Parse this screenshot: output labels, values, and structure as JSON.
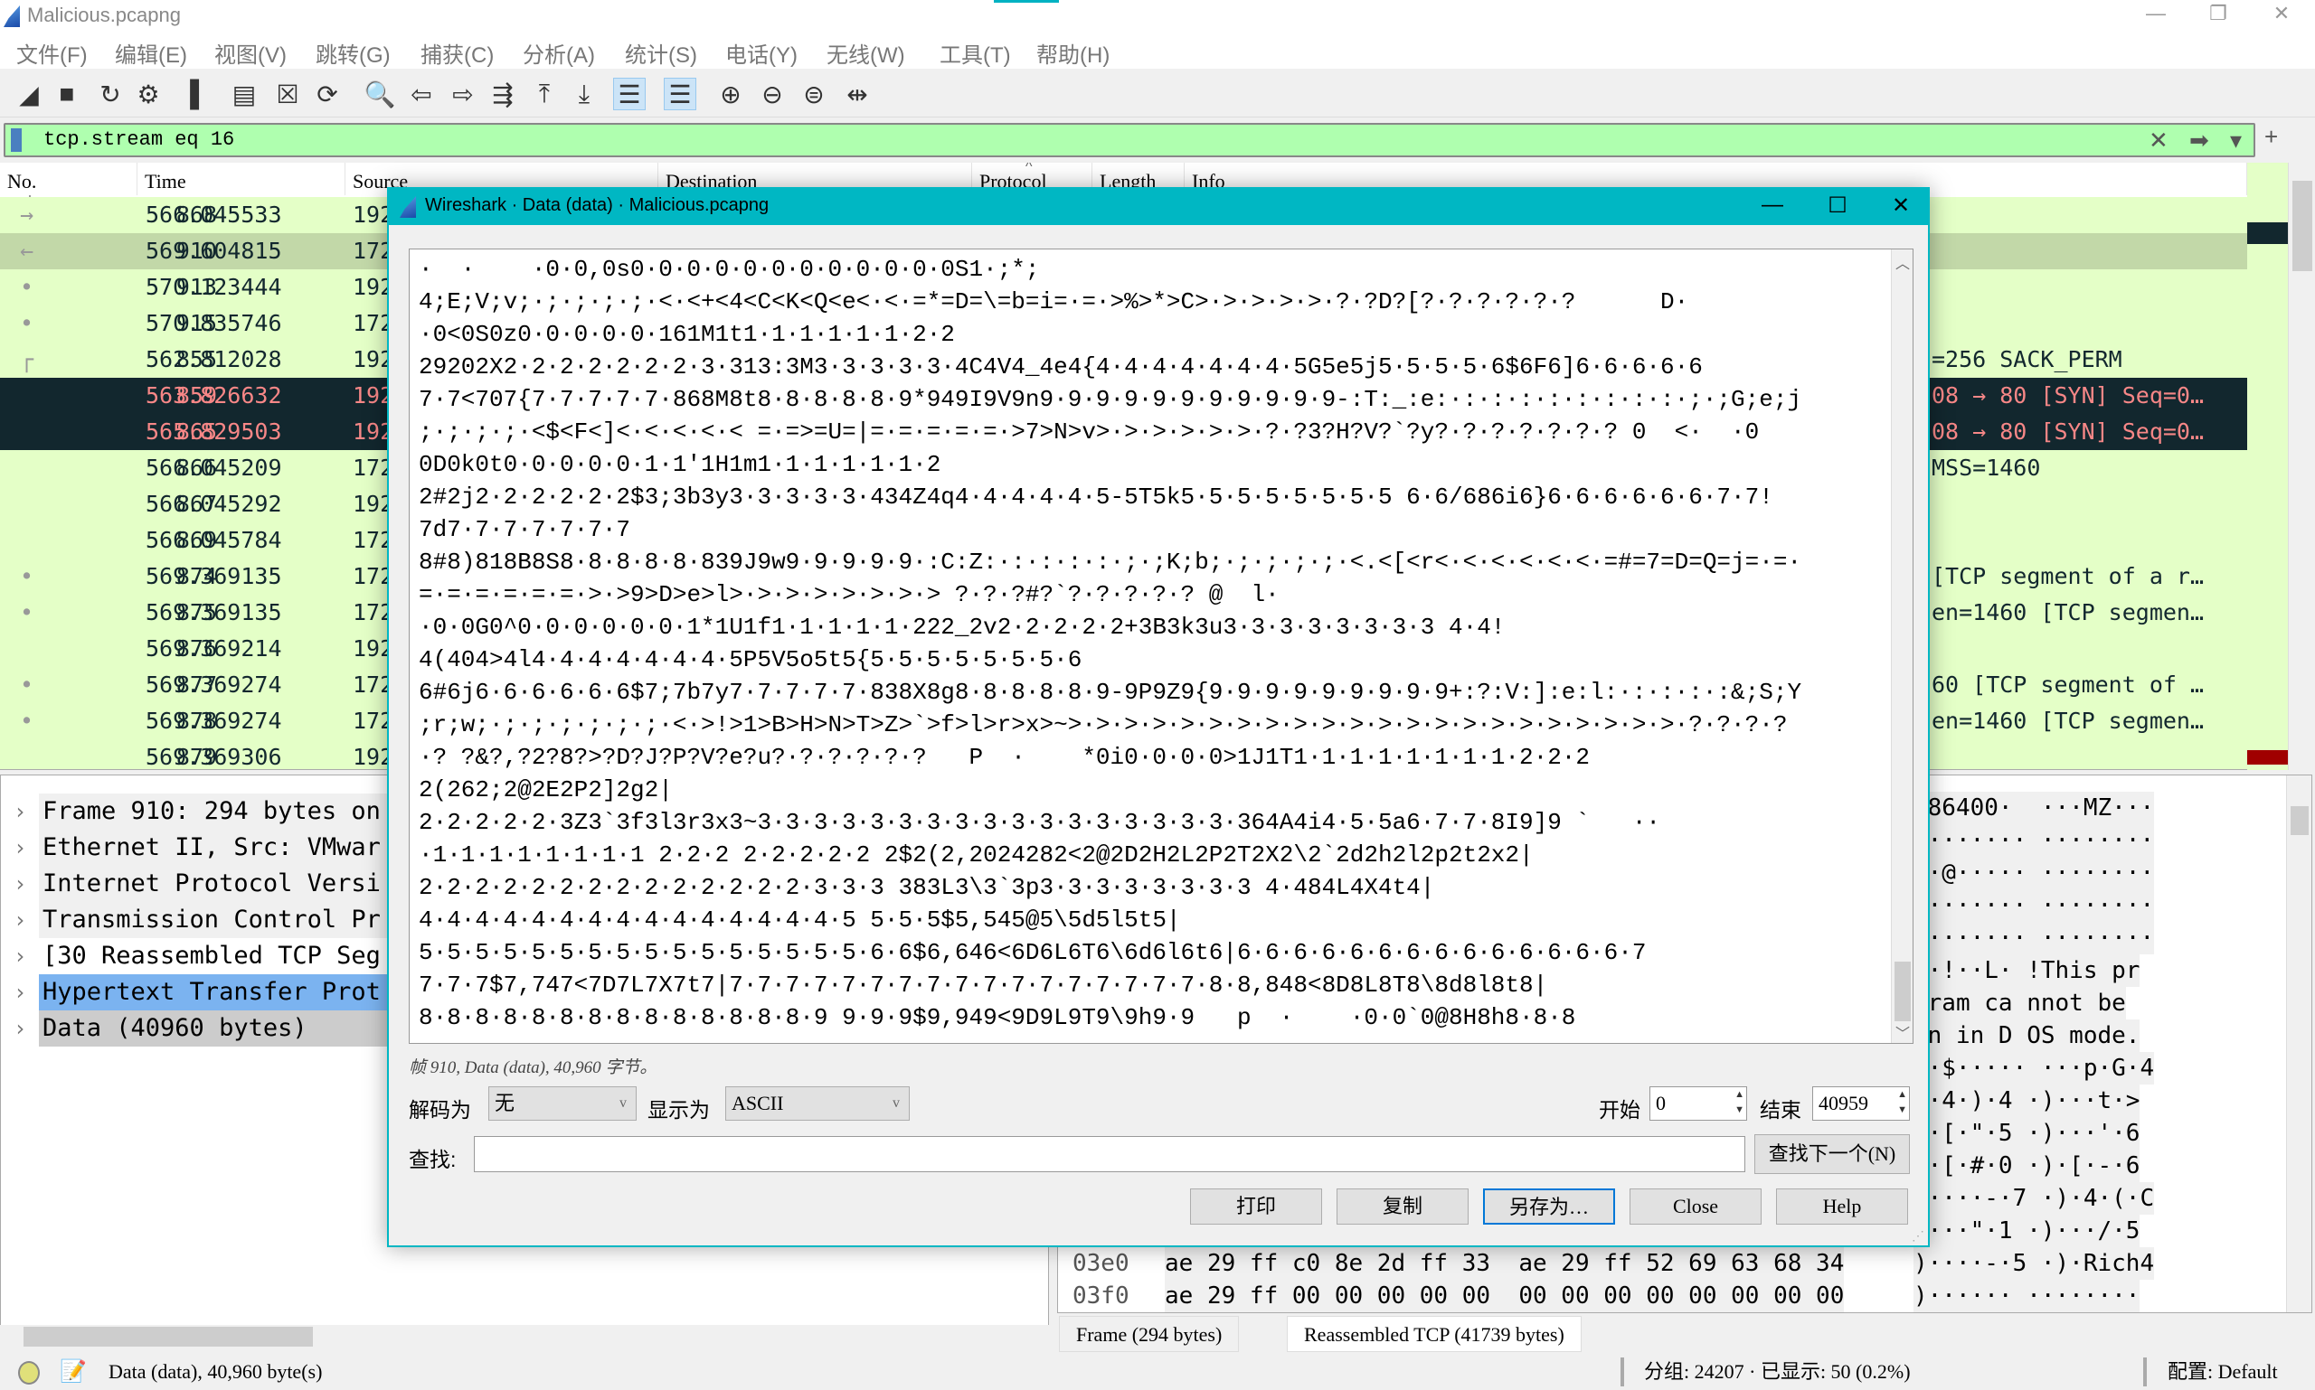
{
  "window": {
    "title": "Malicious.pcapng",
    "controls": [
      "—",
      "❐",
      "✕"
    ]
  },
  "menu": [
    "文件(F)",
    "编辑(E)",
    "视图(V)",
    "跳转(G)",
    "捕获(C)",
    "分析(A)",
    "统计(S)",
    "电话(Y)",
    "无线(W)",
    "工具(T)",
    "帮助(H)"
  ],
  "toolbar": [
    {
      "icon": "start-capture-icon",
      "glyph": "◢"
    },
    {
      "icon": "stop-capture-icon",
      "glyph": "■"
    },
    {
      "icon": "restart-capture-icon",
      "glyph": "↻"
    },
    {
      "icon": "capture-options-icon",
      "glyph": "⚙"
    },
    {
      "icon": "open-file-icon",
      "glyph": "▌"
    },
    {
      "icon": "save-file-icon",
      "glyph": "▤"
    },
    {
      "icon": "close-file-icon",
      "glyph": "☒"
    },
    {
      "icon": "reload-file-icon",
      "glyph": "⟳"
    },
    {
      "icon": "find-packet-icon",
      "glyph": "🔍"
    },
    {
      "icon": "go-back-icon",
      "glyph": "⇦"
    },
    {
      "icon": "go-forward-icon",
      "glyph": "⇨"
    },
    {
      "icon": "go-to-packet-icon",
      "glyph": "⇶"
    },
    {
      "icon": "first-packet-icon",
      "glyph": "⤒"
    },
    {
      "icon": "last-packet-icon",
      "glyph": "⤓"
    },
    {
      "icon": "auto-scroll-icon",
      "glyph": "☰",
      "on": true
    },
    {
      "icon": "colorize-icon",
      "glyph": "☰",
      "on": true
    },
    {
      "icon": "zoom-in-icon",
      "glyph": "⊕"
    },
    {
      "icon": "zoom-out-icon",
      "glyph": "⊖"
    },
    {
      "icon": "zoom-normal-icon",
      "glyph": "⊜"
    },
    {
      "icon": "resize-columns-icon",
      "glyph": "⇹"
    }
  ],
  "filter": {
    "value": "tcp.stream eq 16",
    "clear": "✕",
    "apply": "➡",
    "dropdown": "▾",
    "add": "+"
  },
  "packet_list": {
    "columns": [
      "No.",
      "Time",
      "Source",
      "Destination",
      "Protocol",
      "Length",
      "Info"
    ],
    "sort_indicator": "^",
    "rows": [
      {
        "no": "868",
        "time": "566.045533",
        "src": "192",
        "info": "",
        "mark": "→"
      },
      {
        "no": "910",
        "time": "569.604815",
        "src": "172",
        "info": "",
        "mark": "←",
        "state": "sel"
      },
      {
        "no": "913",
        "time": "570.123444",
        "src": "192",
        "info": "",
        "mark": "•"
      },
      {
        "no": "915",
        "time": "570.835746",
        "src": "172",
        "info": "",
        "mark": "•"
      },
      {
        "no": "855",
        "time": "562.812028",
        "src": "192",
        "info": "=256 SACK_PERM",
        "mark": "┌"
      },
      {
        "no": "859",
        "time": "563.826632",
        "src": "192",
        "info": "08 → 80 [SYN] Seq=0…",
        "state": "dark"
      },
      {
        "no": "865",
        "time": "565.829503",
        "src": "192",
        "info": "08 → 80 [SYN] Seq=0…",
        "state": "dark"
      },
      {
        "no": "866",
        "time": "566.045209",
        "src": "172",
        "info": "MSS=1460"
      },
      {
        "no": "867",
        "time": "566.045292",
        "src": "192",
        "info": ""
      },
      {
        "no": "869",
        "time": "566.045784",
        "src": "172",
        "info": ""
      },
      {
        "no": "874",
        "time": "569.369135",
        "src": "172",
        "info": "[TCP segment of a r…",
        "mark": "•"
      },
      {
        "no": "875",
        "time": "569.369135",
        "src": "172",
        "info": "en=1460 [TCP segmen…",
        "mark": "•"
      },
      {
        "no": "876",
        "time": "569.369214",
        "src": "192",
        "info": ""
      },
      {
        "no": "877",
        "time": "569.369274",
        "src": "172",
        "info": "60 [TCP segment of …",
        "mark": "•"
      },
      {
        "no": "878",
        "time": "569.369274",
        "src": "172",
        "info": "en=1460 [TCP segmen…",
        "mark": "•"
      },
      {
        "no": "879",
        "time": "569.369306",
        "src": "192",
        "info": ""
      }
    ]
  },
  "details": [
    {
      "label": "Frame 910: 294 bytes on",
      "bg": "#f0f0f0"
    },
    {
      "label": "Ethernet II, Src: VMwar",
      "bg": "#f0f0f0"
    },
    {
      "label": "Internet Protocol Versi",
      "bg": "#f0f0f0"
    },
    {
      "label": "Transmission Control Pr",
      "bg": "#f0f0f0"
    },
    {
      "label": "[30 Reassembled TCP Seg",
      "bg": "#ffffff"
    },
    {
      "label": "Hypertext Transfer Prot",
      "bg": "#7bb3f0"
    },
    {
      "label": "Data (40960 bytes)",
      "bg": "#cccccc"
    }
  ],
  "hex": {
    "ascii": [
      "=86400·  ···MZ···",
      "········ ········",
      "··@····· ········",
      "········ ········",
      "········ ········",
      "··!··L· !This pr",
      "gram ca nnot be",
      "un in D OS mode.",
      "··$····· ···p·G·4",
      ")·4·)·4 ·)···t·>",
      ")·[·\"·5 ·)···'·6",
      ")·[·#·0 ·)·[·-·6",
      ")····-·7 ·)·4·(·C",
      ")···\"·1 ·)···/·5",
      ")····-·5 ·)·Rich4",
      ")······ ········"
    ],
    "bottom_rows": [
      {
        "offset": "03e0",
        "bytes": "ae 29 ff c0 8e 2d ff 33  ae 29 ff 52 69 63 68 34"
      },
      {
        "offset": "03f0",
        "bytes": "ae 29 ff 00 00 00 00 00  00 00 00 00 00 00 00 00"
      }
    ],
    "tabs": [
      "Frame (294 bytes)",
      "Reassembled TCP (41739 bytes)"
    ]
  },
  "status": {
    "left": "Data (data), 40,960 byte(s)",
    "packets": "分组: 24207 · 已显示: 50 (0.2%)",
    "profile": "配置: Default",
    "ready_color": "#e0e07a"
  },
  "dialog": {
    "title": "Wireshark · Data (data) · Malicious.pcapng",
    "controls": [
      "—",
      "☐",
      "✕"
    ],
    "lines": [
      "·  ·    ·0·0,0s0·0·0·0·0·0·0·0·0·0·0·0S1·;*;",
      "4;E;V;v;·;·;·;·;·<·<+<4<C<K<Q<e<·<·=*=D=\\=b=i=·=·>%>*>C>·>·>·>·>·?·?D?[?·?·?·?·?·?      D·",
      "·0<0S0z0·0·0·0·0·161M1t1·1·1·1·1·1·2·2",
      "29202X2·2·2·2·2·2·2·3·313:3M3·3·3·3·3·4C4V4_4e4{4·4·4·4·4·4·4·5G5e5j5·5·5·5·6$6F6]6·6·6·6·6",
      "7·7<707{7·7·7·7·7·868M8t8·8·8·8·8·9*949I9V9n9·9·9·9·9·9·9·9·9·9·9-:T:_:e:·:·:·:·:·:·:·:·:·;·;G;e;j",
      ";·;·;·;·<$<F<]<·<·<·<·< =·=>=U=|=·=·=·=·=·>7>N>v>·>·>·>·>·>·?·?3?H?V?`?y?·?·?·?·?·?·? 0  <·  ·0",
      "0D0k0t0·0·0·0·0·1·1'1H1m1·1·1·1·1·1·2",
      "2#2j2·2·2·2·2·2$3;3b3y3·3·3·3·3·434Z4q4·4·4·4·4·5-5T5k5·5·5·5·5·5·5·5 6·6/686i6}6·6·6·6·6·6·7·7!",
      "7d7·7·7·7·7·7·7",
      "8#8)818B8S8·8·8·8·8·839J9w9·9·9·9·9·:C:Z:·:·:·:·:·;·;K;b;·;·;·;·;·<.<[<r<·<·<·<·<·<·=#=7=D=Q=j=·=·",
      "=·=·=·=·=·=·>·>9>D>e>l>·>·>·>·>·>·>·> ?·?·?#?`?·?·?·?·? @  l·",
      "·0·0G0^0·0·0·0·0·0·1*1U1f1·1·1·1·1·222_2v2·2·2·2·2+3B3k3u3·3·3·3·3·3·3·3 4·4!",
      "4(404>4l4·4·4·4·4·4·4·5P5V5o5t5{5·5·5·5·5·5·5·6",
      "6#6j6·6·6·6·6·6$7;7b7y7·7·7·7·7·838X8g8·8·8·8·8·9-9P9Z9{9·9·9·9·9·9·9·9·9+:?:V:]:e:l:·:·:·:·:&;S;Y",
      ";r;w;·;·;·;·;·;·;·<·>!>1>B>H>N>T>Z>`>f>l>r>x>~>·>·>·>·>·>·>·>·>·>·>·>·>·>·>·>·>·>·>·>·>·>·?·?·?·?",
      "·? ?&?,?2?8?>?D?J?P?V?e?u?·?·?·?·?·?   P  ·    *0i0·0·0·0>1J1T1·1·1·1·1·1·1·1·2·2·2",
      "2(262;2@2E2P2]2g2|",
      "2·2·2·2·2·3Z3`3f3l3r3x3~3·3·3·3·3·3·3·3·3·3·3·3·3·3·3·3·3·364A4i4·5·5a6·7·7·8I9]9 `   ··",
      "·1·1·1·1·1·1·1·1 2·2·2 2·2·2·2·2 2$2(2,2024282<2@2D2H2L2P2T2X2\\2`2d2h2l2p2t2x2|",
      "2·2·2·2·2·2·2·2·2·2·2·2·2·2·3·3·3 383L3\\3`3p3·3·3·3·3·3·3·3 4·484L4X4t4|",
      "4·4·4·4·4·4·4·4·4·4·4·4·4·4·4·5 5·5·5$5,545@5\\5d5l5t5|",
      "5·5·5·5·5·5·5·5·5·5·5·5·5·5·5·5·6·6$6,646<6D6L6T6\\6d6l6t6|6·6·6·6·6·6·6·6·6·6·6·6·6·6·7",
      "7·7·7$7,747<7D7L7X7t7|7·7·7·7·7·7·7·7·7·7·7·7·7·7·7·7·7·8·8,848<8D8L8T8\\8d8l8t8|",
      "8·8·8·8·8·8·8·8·8·8·8·8·8·8·9 9·9·9$9,949<9D9L9T9\\9h9·9   p  ·    ·0·0`0@8H8h8·8·8"
    ],
    "info": "帧 910, Data (data), 40,960 字节。",
    "decode_label": "解码为",
    "decode_value": "无",
    "show_label": "显示为",
    "show_value": "ASCII",
    "start_label": "开始",
    "start_value": "0",
    "end_label": "结束",
    "end_value": "40959",
    "find_label": "查找:",
    "find_value": "",
    "find_next": "查找下一个(N)",
    "buttons": {
      "print": "打印",
      "copy": "复制",
      "save_as": "另存为…",
      "close": "Close",
      "help": "Help"
    }
  }
}
